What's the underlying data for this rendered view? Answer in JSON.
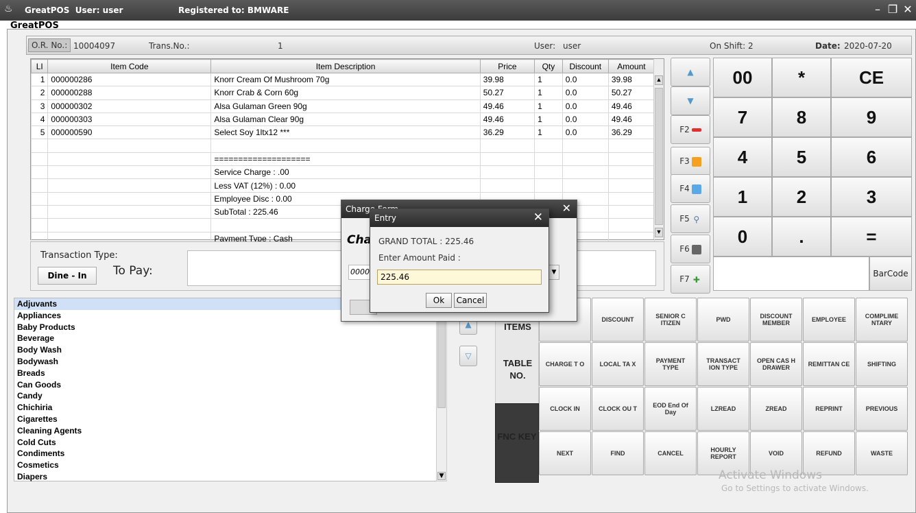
{
  "window": {
    "title_app": "GreatPOS",
    "title_user": "User: user",
    "registered": "Registered to: BMWARE",
    "app_label": "GreatPOS",
    "min": "–",
    "max": "❐",
    "close": "✕"
  },
  "topbar": {
    "or_label": "O.R. No.:",
    "or_no": "10004097",
    "trans_label": "Trans.No.:",
    "trans_no": "1",
    "user_label": "User:",
    "user": "user",
    "shift_label": "On Shift:",
    "shift": "2",
    "date_label": "Date:",
    "date": "2020-07-20"
  },
  "grid": {
    "headers": [
      "LI",
      "Item Code",
      "Item Description",
      "Price",
      "Qty",
      "Discount",
      "Amount"
    ],
    "rows": [
      [
        "1",
        "000000286",
        "Knorr Cream Of Mushroom 70g",
        "39.98",
        "1",
        "0.0",
        "39.98"
      ],
      [
        "2",
        "000000288",
        "Knorr Crab & Corn 60g",
        "50.27",
        "1",
        "0.0",
        "50.27"
      ],
      [
        "3",
        "000000302",
        "Alsa Gulaman Green 90g",
        "49.46",
        "1",
        "0.0",
        "49.46"
      ],
      [
        "4",
        "000000303",
        "Alsa Gulaman Clear 90g",
        "49.46",
        "1",
        "0.0",
        "49.46"
      ],
      [
        "5",
        "000000590",
        "Select Soy 1ltx12 ***",
        "36.29",
        "1",
        "0.0",
        "36.29"
      ],
      [
        "",
        "",
        "",
        "",
        "",
        "",
        ""
      ],
      [
        "",
        "",
        "====================",
        "",
        "",
        "",
        ""
      ],
      [
        "",
        "",
        "Service Charge : .00",
        "",
        "",
        "",
        ""
      ],
      [
        "",
        "",
        "Less VAT (12%) : 0.00",
        "",
        "",
        "",
        ""
      ],
      [
        "",
        "",
        "Employee Disc : 0.00",
        "",
        "",
        "",
        ""
      ],
      [
        "",
        "",
        "SubTotal : 225.46",
        "",
        "",
        "",
        ""
      ],
      [
        "",
        "",
        "",
        "",
        "",
        "",
        ""
      ],
      [
        "",
        "",
        "Payment Type : Cash",
        "",
        "",
        "",
        ""
      ]
    ]
  },
  "transaction": {
    "label": "Transaction Type:",
    "type": "Dine - In",
    "to_pay_label": "To Pay:"
  },
  "side": {
    "f2": "F2",
    "f3": "F3",
    "f4": "F4",
    "f5": "F5",
    "f6": "F6",
    "f7": "F7"
  },
  "keypad": {
    "k00": "00",
    "star": "*",
    "ce": "CE",
    "k7": "7",
    "k8": "8",
    "k9": "9",
    "k4": "4",
    "k5": "5",
    "k6": "6",
    "k1": "1",
    "k2": "2",
    "k3": "3",
    "k0": "0",
    "dot": ".",
    "eq": "=",
    "barcode": "BarCode"
  },
  "categories": [
    "Adjuvants",
    "Appliances",
    "Baby Products",
    "Beverage",
    "Body Wash",
    "Bodywash",
    "Breads",
    "Can Goods",
    "Candy",
    "Chichiria",
    "Cigarettes",
    "Cleaning Agents",
    "Cold Cuts",
    "Condiments",
    "Cosmetics",
    "Diapers"
  ],
  "tabs": {
    "items": "ITEMS",
    "table": "TABLE NO.",
    "fnc": "FNC KEY"
  },
  "functions": [
    [
      "",
      "DISCOUNT",
      "SENIOR C ITIZEN",
      "PWD",
      "DISCOUNT MEMBER",
      "EMPLOYEE",
      "COMPLIME NTARY"
    ],
    [
      "CHARGE T O",
      "LOCAL TA X",
      "PAYMENT TYPE",
      "TRANSACT ION TYPE",
      "OPEN CAS H DRAWER",
      "REMITTAN CE",
      "SHIFTING"
    ],
    [
      "CLOCK IN",
      "CLOCK OU T",
      "EOD End Of Day",
      "LZREAD",
      "ZREAD",
      "REPRINT",
      "PREVIOUS"
    ],
    [
      "NEXT",
      "FIND",
      "CANCEL",
      "HOURLY REPORT",
      "VOID",
      "REFUND",
      "WASTE"
    ]
  ],
  "charge_form": {
    "title": "Charge Form",
    "heading": "Cha",
    "code": "0000",
    "close": "✕"
  },
  "entry": {
    "title": "Entry",
    "grand_total": "GRAND TOTAL : 225.46",
    "prompt": "Enter Amount Paid :",
    "value": "225.46",
    "ok": "Ok",
    "cancel": "Cancel",
    "close": "✕"
  },
  "watermark": {
    "line1": "Activate Windows",
    "line2": "Go to Settings to activate Windows."
  }
}
